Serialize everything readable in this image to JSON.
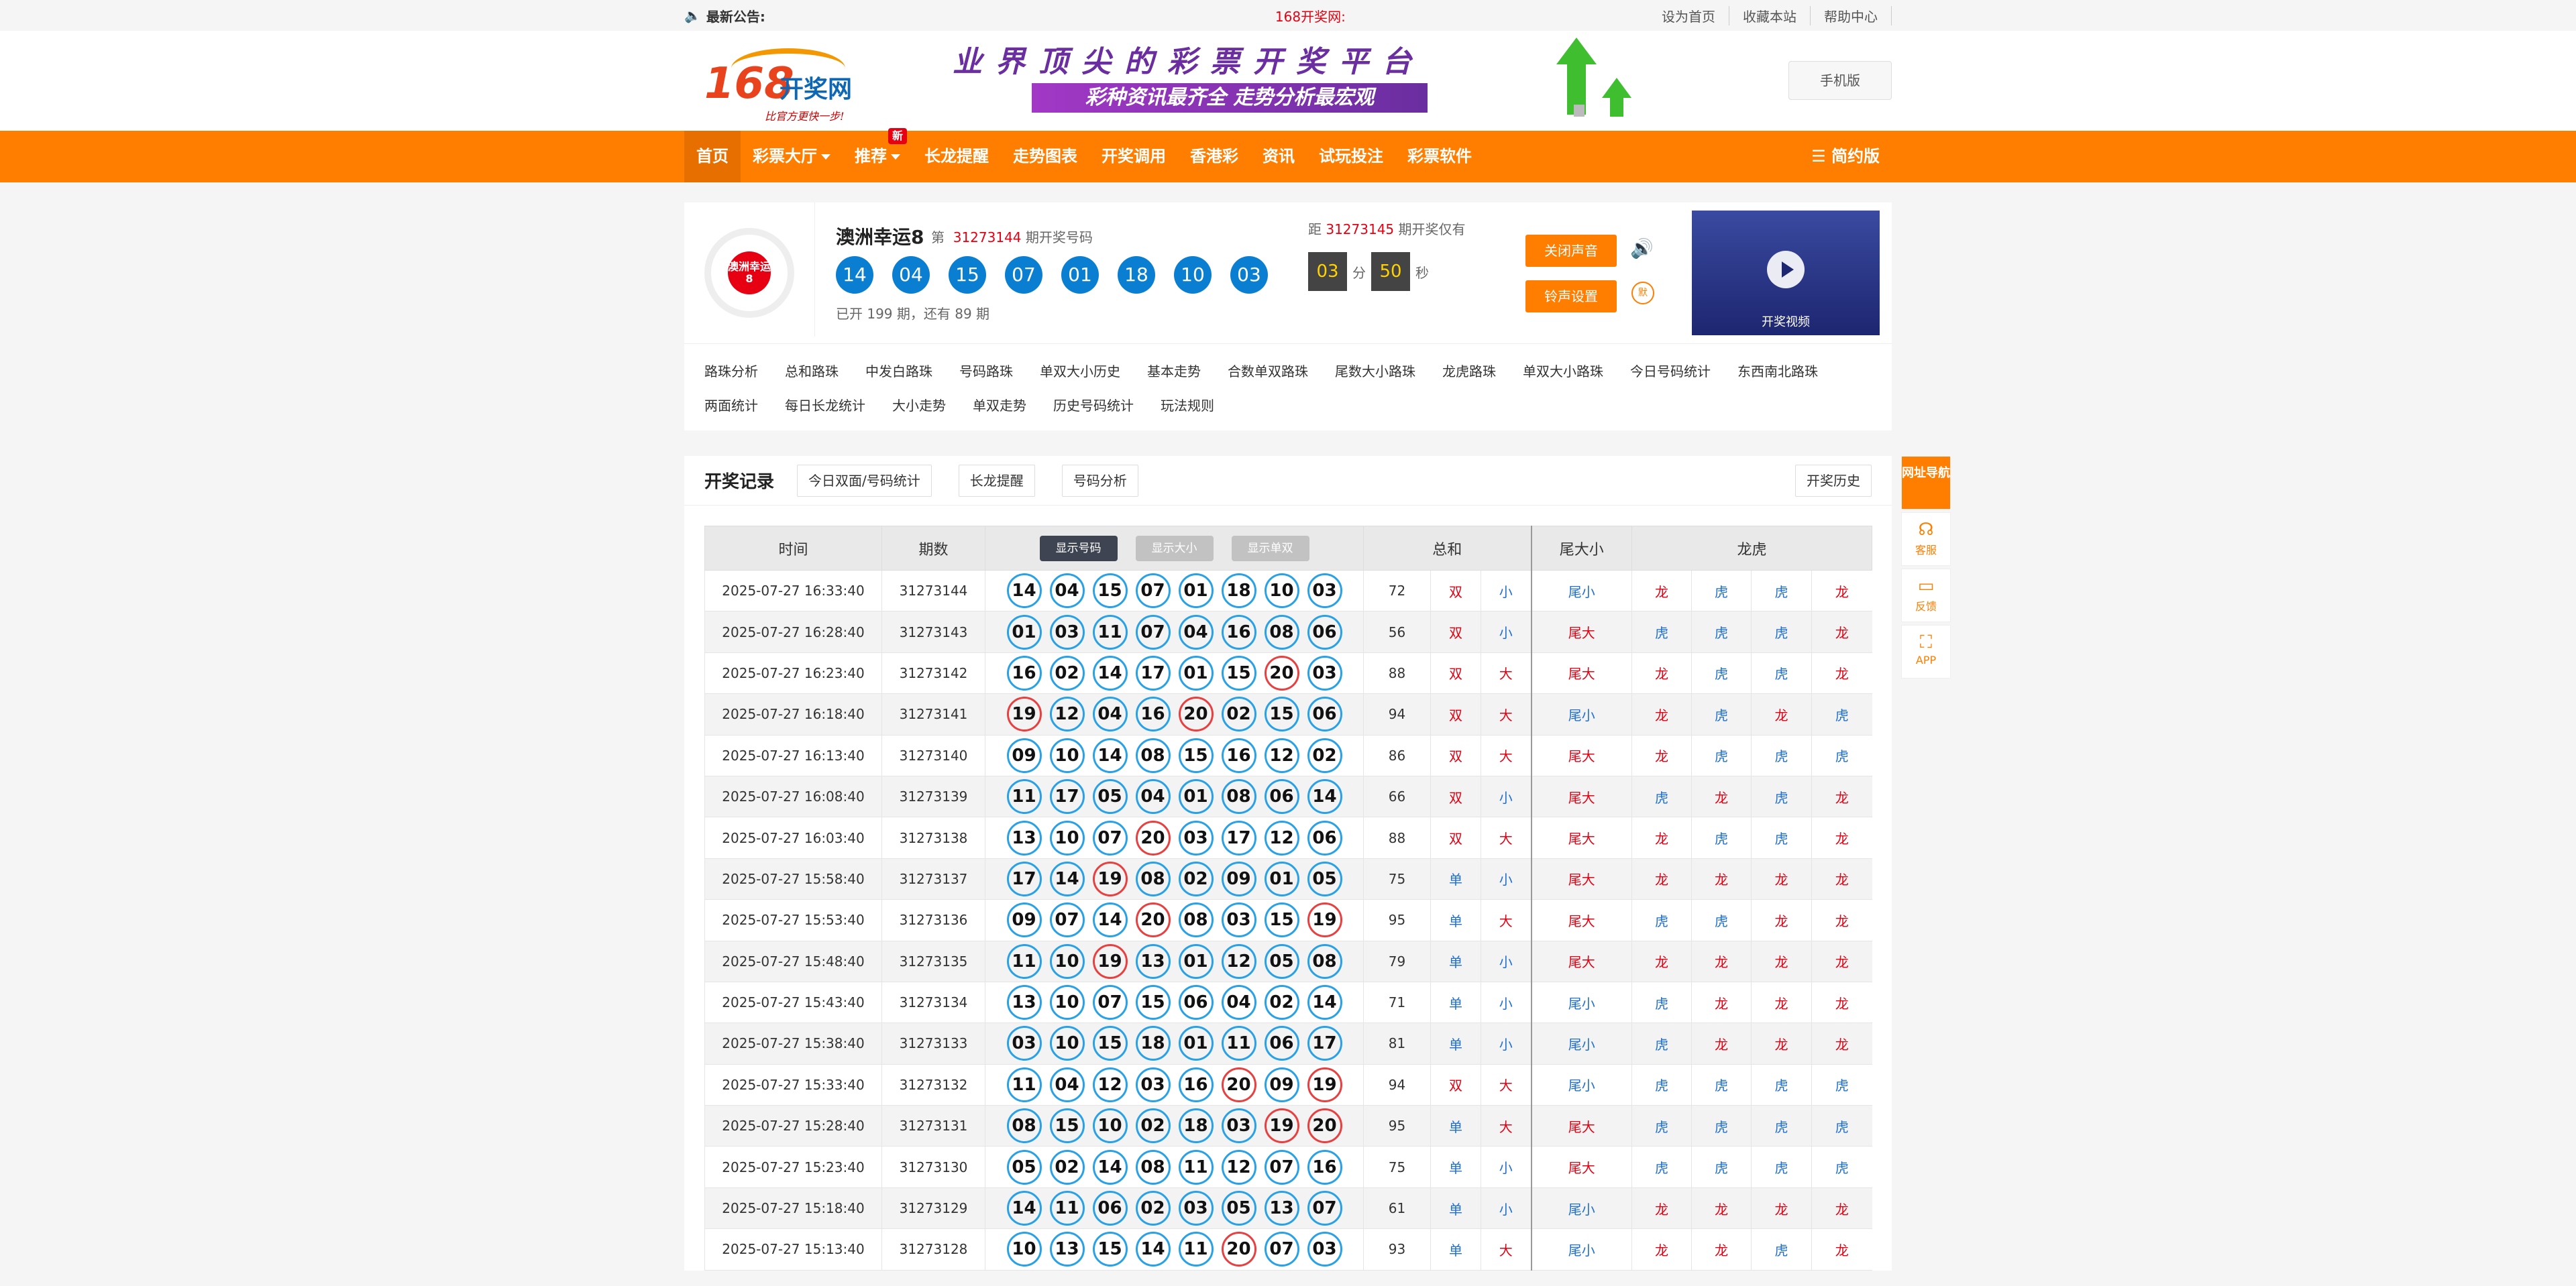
{
  "topbar": {
    "announce_label": "最新公告:",
    "site_name": "168开奖网:",
    "links": [
      "设为首页",
      "收藏本站",
      "帮助中心"
    ]
  },
  "header": {
    "logo_num": "168",
    "logo_text": "开奖网",
    "slogan": "比官方更快一步!",
    "banner_line1": "业界顶尖的彩票开奖平台",
    "banner_line2": "彩种资讯最齐全 走势分析最宏观",
    "mobile_button": "手机版"
  },
  "nav": {
    "items": [
      "首页",
      "彩票大厅",
      "推荐",
      "长龙提醒",
      "走势图表",
      "开奖调用",
      "香港彩",
      "资讯",
      "试玩投注",
      "彩票软件"
    ],
    "badge_new": "新",
    "right": "简约版"
  },
  "draw": {
    "logo_text": "澳洲幸运8",
    "name": "澳洲幸运8",
    "issue_prefix": "第",
    "issue": "31273144",
    "issue_suffix": "期开奖号码",
    "numbers": [
      "14",
      "04",
      "15",
      "07",
      "01",
      "18",
      "10",
      "03"
    ],
    "count_text": "已开 199 期，还有 89 期",
    "next_prefix": "距",
    "next_issue": "31273145",
    "next_suffix": "期开奖仅有",
    "minutes": "03",
    "min_label": "分",
    "seconds": "50",
    "sec_label": "秒",
    "close_sound": "关闭声音",
    "ring_setting": "铃声设置",
    "mute_label": "默",
    "video_label": "开奖视频"
  },
  "links": [
    "路珠分析",
    "总和路珠",
    "中发白路珠",
    "号码路珠",
    "单双大小历史",
    "基本走势",
    "合数单双路珠",
    "尾数大小路珠",
    "龙虎路珠",
    "单双大小路珠",
    "今日号码统计",
    "东西南北路珠",
    "两面统计",
    "每日长龙统计",
    "大小走势",
    "单双走势",
    "历史号码统计",
    "玩法规则"
  ],
  "records": {
    "title": "开奖记录",
    "tags": [
      "今日双面/号码统计",
      "长龙提醒",
      "号码分析"
    ],
    "history": "开奖历史",
    "columns": {
      "time": "时间",
      "issue": "期数",
      "sum": "总和",
      "tail": "尾大小",
      "dragon": "龙虎"
    },
    "toggles": [
      "显示号码",
      "显示大小",
      "显示单双"
    ],
    "rows": [
      {
        "time": "2025-07-27 16:33:40",
        "issue": "31273144",
        "nums": [
          "14",
          "04",
          "15",
          "07",
          "01",
          "18",
          "10",
          "03"
        ],
        "sum": "72",
        "oe": "双",
        "bs": "小",
        "tail": "尾小",
        "lh": [
          "龙",
          "虎",
          "虎",
          "龙"
        ]
      },
      {
        "time": "2025-07-27 16:28:40",
        "issue": "31273143",
        "nums": [
          "01",
          "03",
          "11",
          "07",
          "04",
          "16",
          "08",
          "06"
        ],
        "sum": "56",
        "oe": "双",
        "bs": "小",
        "tail": "尾大",
        "lh": [
          "虎",
          "虎",
          "虎",
          "龙"
        ]
      },
      {
        "time": "2025-07-27 16:23:40",
        "issue": "31273142",
        "nums": [
          "16",
          "02",
          "14",
          "17",
          "01",
          "15",
          "20",
          "03"
        ],
        "sum": "88",
        "oe": "双",
        "bs": "大",
        "tail": "尾大",
        "lh": [
          "龙",
          "虎",
          "虎",
          "龙"
        ]
      },
      {
        "time": "2025-07-27 16:18:40",
        "issue": "31273141",
        "nums": [
          "19",
          "12",
          "04",
          "16",
          "20",
          "02",
          "15",
          "06"
        ],
        "sum": "94",
        "oe": "双",
        "bs": "大",
        "tail": "尾小",
        "lh": [
          "龙",
          "虎",
          "龙",
          "虎"
        ]
      },
      {
        "time": "2025-07-27 16:13:40",
        "issue": "31273140",
        "nums": [
          "09",
          "10",
          "14",
          "08",
          "15",
          "16",
          "12",
          "02"
        ],
        "sum": "86",
        "oe": "双",
        "bs": "大",
        "tail": "尾大",
        "lh": [
          "龙",
          "虎",
          "虎",
          "虎"
        ]
      },
      {
        "time": "2025-07-27 16:08:40",
        "issue": "31273139",
        "nums": [
          "11",
          "17",
          "05",
          "04",
          "01",
          "08",
          "06",
          "14"
        ],
        "sum": "66",
        "oe": "双",
        "bs": "小",
        "tail": "尾大",
        "lh": [
          "虎",
          "龙",
          "虎",
          "龙"
        ]
      },
      {
        "time": "2025-07-27 16:03:40",
        "issue": "31273138",
        "nums": [
          "13",
          "10",
          "07",
          "20",
          "03",
          "17",
          "12",
          "06"
        ],
        "sum": "88",
        "oe": "双",
        "bs": "大",
        "tail": "尾大",
        "lh": [
          "龙",
          "虎",
          "虎",
          "龙"
        ]
      },
      {
        "time": "2025-07-27 15:58:40",
        "issue": "31273137",
        "nums": [
          "17",
          "14",
          "19",
          "08",
          "02",
          "09",
          "01",
          "05"
        ],
        "sum": "75",
        "oe": "单",
        "bs": "小",
        "tail": "尾大",
        "lh": [
          "龙",
          "龙",
          "龙",
          "龙"
        ]
      },
      {
        "time": "2025-07-27 15:53:40",
        "issue": "31273136",
        "nums": [
          "09",
          "07",
          "14",
          "20",
          "08",
          "03",
          "15",
          "19"
        ],
        "sum": "95",
        "oe": "单",
        "bs": "大",
        "tail": "尾大",
        "lh": [
          "虎",
          "虎",
          "龙",
          "龙"
        ]
      },
      {
        "time": "2025-07-27 15:48:40",
        "issue": "31273135",
        "nums": [
          "11",
          "10",
          "19",
          "13",
          "01",
          "12",
          "05",
          "08"
        ],
        "sum": "79",
        "oe": "单",
        "bs": "小",
        "tail": "尾大",
        "lh": [
          "龙",
          "龙",
          "龙",
          "龙"
        ]
      },
      {
        "time": "2025-07-27 15:43:40",
        "issue": "31273134",
        "nums": [
          "13",
          "10",
          "07",
          "15",
          "06",
          "04",
          "02",
          "14"
        ],
        "sum": "71",
        "oe": "单",
        "bs": "小",
        "tail": "尾小",
        "lh": [
          "虎",
          "龙",
          "龙",
          "龙"
        ]
      },
      {
        "time": "2025-07-27 15:38:40",
        "issue": "31273133",
        "nums": [
          "03",
          "10",
          "15",
          "18",
          "01",
          "11",
          "06",
          "17"
        ],
        "sum": "81",
        "oe": "单",
        "bs": "小",
        "tail": "尾小",
        "lh": [
          "虎",
          "龙",
          "龙",
          "龙"
        ]
      },
      {
        "time": "2025-07-27 15:33:40",
        "issue": "31273132",
        "nums": [
          "11",
          "04",
          "12",
          "03",
          "16",
          "20",
          "09",
          "19"
        ],
        "sum": "94",
        "oe": "双",
        "bs": "大",
        "tail": "尾小",
        "lh": [
          "虎",
          "虎",
          "虎",
          "虎"
        ]
      },
      {
        "time": "2025-07-27 15:28:40",
        "issue": "31273131",
        "nums": [
          "08",
          "15",
          "10",
          "02",
          "18",
          "03",
          "19",
          "20"
        ],
        "sum": "95",
        "oe": "单",
        "bs": "大",
        "tail": "尾大",
        "lh": [
          "虎",
          "虎",
          "虎",
          "虎"
        ]
      },
      {
        "time": "2025-07-27 15:23:40",
        "issue": "31273130",
        "nums": [
          "05",
          "02",
          "14",
          "08",
          "11",
          "12",
          "07",
          "16"
        ],
        "sum": "75",
        "oe": "单",
        "bs": "小",
        "tail": "尾大",
        "lh": [
          "虎",
          "虎",
          "虎",
          "虎"
        ]
      },
      {
        "time": "2025-07-27 15:18:40",
        "issue": "31273129",
        "nums": [
          "14",
          "11",
          "06",
          "02",
          "03",
          "05",
          "13",
          "07"
        ],
        "sum": "61",
        "oe": "单",
        "bs": "小",
        "tail": "尾小",
        "lh": [
          "龙",
          "龙",
          "龙",
          "龙"
        ]
      },
      {
        "time": "2025-07-27 15:13:40",
        "issue": "31273128",
        "nums": [
          "10",
          "13",
          "15",
          "14",
          "11",
          "20",
          "07",
          "03"
        ],
        "sum": "93",
        "oe": "单",
        "bs": "大",
        "tail": "尾小",
        "lh": [
          "龙",
          "龙",
          "虎",
          "龙"
        ]
      }
    ]
  },
  "side": {
    "top": "网址导航",
    "items": [
      "客服",
      "反馈",
      "APP"
    ]
  },
  "colors": {
    "orange": "#ff7e00",
    "blue": "#0a7fd2",
    "red": "#e60012",
    "ball_border": "#29a1e6",
    "ball_red": "#e84040"
  }
}
